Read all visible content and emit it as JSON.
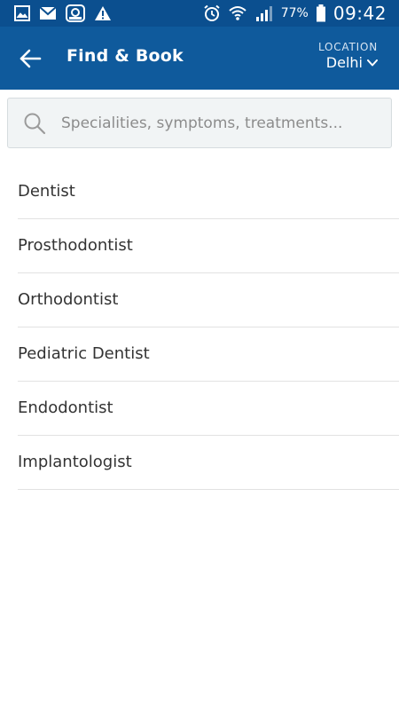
{
  "status_bar": {
    "battery_percent": "77%",
    "time": "09:42"
  },
  "app_bar": {
    "title": "Find & Book",
    "location_label": "LOCATION",
    "location_value": "Delhi"
  },
  "search": {
    "placeholder": "Specialities, symptoms, treatments..."
  },
  "specialities": [
    {
      "label": "Dentist"
    },
    {
      "label": "Prosthodontist"
    },
    {
      "label": "Orthodontist"
    },
    {
      "label": "Pediatric Dentist"
    },
    {
      "label": "Endodontist"
    },
    {
      "label": "Implantologist"
    }
  ],
  "colors": {
    "status_bar": "#0b4f8f",
    "app_bar": "#0f5a9c",
    "search_background": "#f1f4f5",
    "text": "#333333",
    "divider": "#e2e2e2"
  }
}
